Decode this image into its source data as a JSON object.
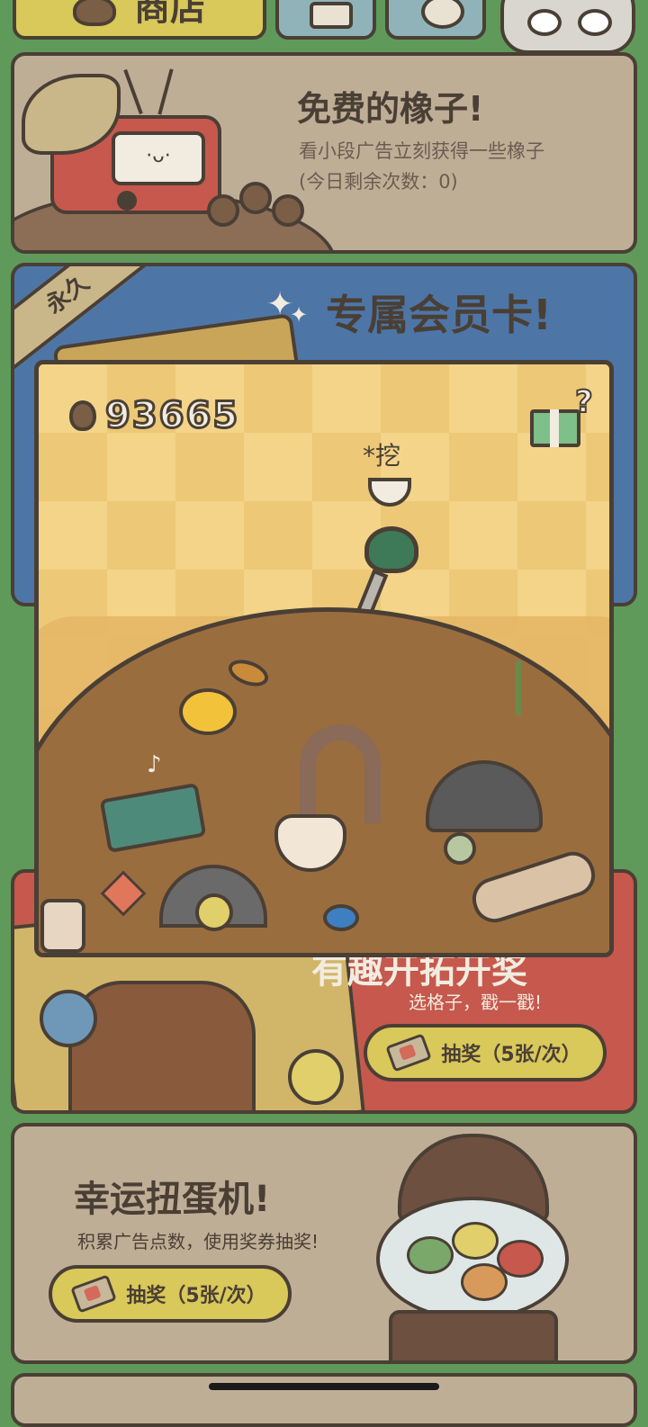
{
  "header": {
    "shop_tab_label": "商店"
  },
  "free_acorns_card": {
    "title": "免费的橡子!",
    "description": "看小段广告立刻获得一些橡子",
    "remaining_text": "(今日剩余次数：0)"
  },
  "membership_card": {
    "badge": "永久",
    "title": "专属会员卡!"
  },
  "dig_popup": {
    "acorn_count": "93665",
    "dig_label": "*挖"
  },
  "lottery_card": {
    "title_partial": "有趣开拓开奖",
    "subtitle": "选格子，戳一戳!",
    "button_label": "抽奖（5张/次）"
  },
  "gacha_card": {
    "title": "幸运扭蛋机!",
    "subtitle": "积累广告点数，使用奖券抽奖!",
    "button_label": "抽奖（5张/次）"
  },
  "colors": {
    "background_green": "#5f9a5a",
    "outline_brown": "#4a3f35",
    "card_tan": "#bfae96",
    "membership_blue": "#4d76a7",
    "popup_yellow": "#f3d489",
    "lottery_red": "#c6584d",
    "button_yellow": "#d9c85a"
  }
}
